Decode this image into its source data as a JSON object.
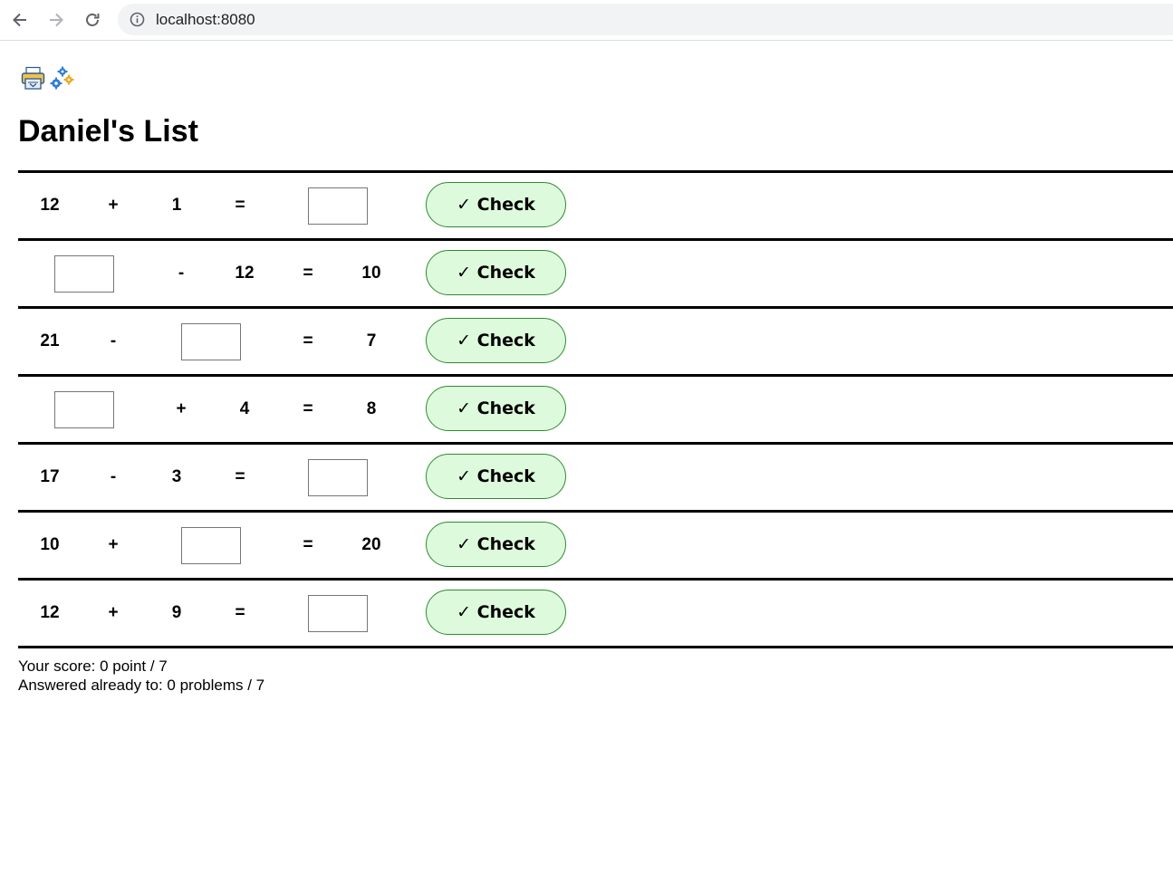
{
  "browser": {
    "url": "localhost:8080"
  },
  "toolbar": {
    "icons": [
      "printer-icon",
      "gears-icon"
    ]
  },
  "page": {
    "title": "Daniel's List"
  },
  "problems": [
    {
      "operand_a": "12",
      "operator": "+",
      "operand_b": "1",
      "equals": "=",
      "result": "",
      "blank": "result"
    },
    {
      "operand_a": "",
      "operator": "-",
      "operand_b": "12",
      "equals": "=",
      "result": "10",
      "blank": "operand_a"
    },
    {
      "operand_a": "21",
      "operator": "-",
      "operand_b": "",
      "equals": "=",
      "result": "7",
      "blank": "operand_b"
    },
    {
      "operand_a": "",
      "operator": "+",
      "operand_b": "4",
      "equals": "=",
      "result": "8",
      "blank": "operand_a"
    },
    {
      "operand_a": "17",
      "operator": "-",
      "operand_b": "3",
      "equals": "=",
      "result": "",
      "blank": "result"
    },
    {
      "operand_a": "10",
      "operator": "+",
      "operand_b": "",
      "equals": "=",
      "result": "20",
      "blank": "operand_b"
    },
    {
      "operand_a": "12",
      "operator": "+",
      "operand_b": "9",
      "equals": "=",
      "result": "",
      "blank": "result"
    }
  ],
  "check_label": "✓ Check",
  "score": {
    "score_line": "Your score: 0 point / 7",
    "answered_line": "Answered already to: 0 problems / 7"
  },
  "colors": {
    "check_button_bg": "#ddfadd",
    "check_button_border": "#2e8b2e"
  }
}
